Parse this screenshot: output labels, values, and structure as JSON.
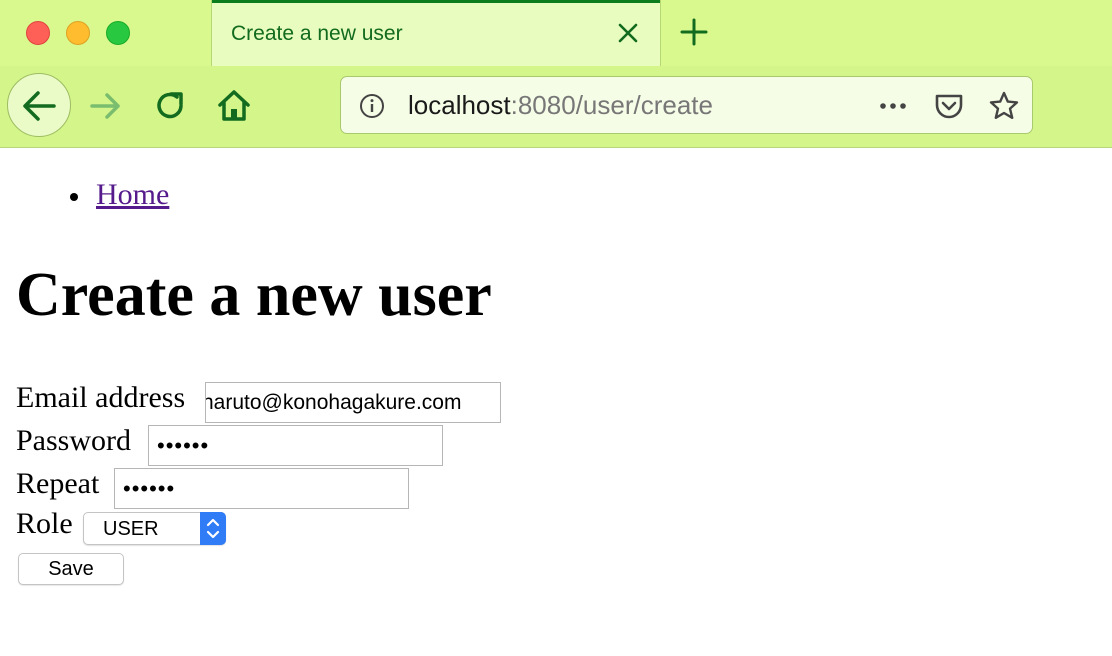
{
  "browser": {
    "tab_title": "Create a new user",
    "url_host": "localhost",
    "url_rest": ":8080/user/create",
    "colors": {
      "chrome": "#d3f58a",
      "accent": "#126b1e"
    }
  },
  "nav": {
    "items": [
      {
        "label": "Home"
      }
    ]
  },
  "page": {
    "heading": "Create a new user"
  },
  "form": {
    "email_label": "Email address",
    "email_value": "naruto@konohagakure.com",
    "password_label": "Password",
    "password_mask": "••••••",
    "repeat_label": "Repeat",
    "repeat_mask": "••••••",
    "role_label": "Role",
    "role_value": "USER",
    "save_label": "Save"
  }
}
